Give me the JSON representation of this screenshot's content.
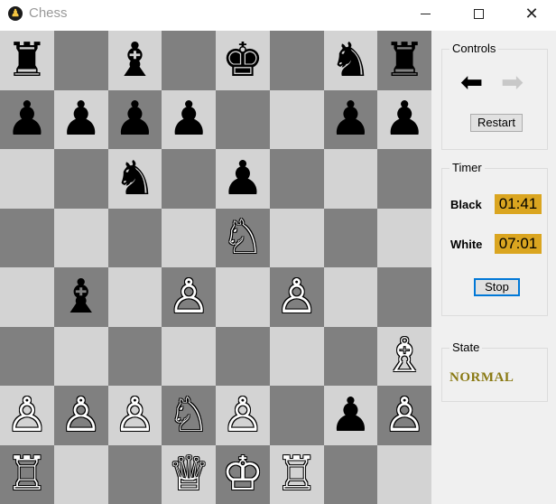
{
  "window": {
    "title": "Chess",
    "app_icon": "chess-pawn-icon",
    "minimize_icon": "minimize-icon",
    "maximize_icon": "maximize-icon",
    "close_icon": "close-icon"
  },
  "board": {
    "light_color": "#d3d3d3",
    "dark_color": "#808080",
    "rows": [
      [
        "♜",
        "",
        "♝",
        "",
        "♚",
        "",
        "♞",
        "♜"
      ],
      [
        "♟",
        "♟",
        "♟",
        "♟",
        "",
        "",
        "♟",
        "♟"
      ],
      [
        "",
        "",
        "♞",
        "",
        "♟",
        "",
        "",
        ""
      ],
      [
        "",
        "",
        "",
        "",
        "♘",
        "",
        "",
        ""
      ],
      [
        "",
        "♝",
        "",
        "♙",
        "",
        "♙",
        "",
        ""
      ],
      [
        "",
        "",
        "",
        "",
        "",
        "",
        "",
        "♗"
      ],
      [
        "♙",
        "♙",
        "♙",
        "♘",
        "♙",
        "",
        "♟",
        "♙"
      ],
      [
        "♖",
        "",
        "",
        "♕",
        "♔",
        "♖",
        "",
        ""
      ]
    ],
    "colors": [
      [
        "b",
        "",
        "b",
        "",
        "b",
        "",
        "b",
        "b"
      ],
      [
        "b",
        "b",
        "b",
        "b",
        "",
        "",
        "b",
        "b"
      ],
      [
        "",
        "",
        "b",
        "",
        "b",
        "",
        "",
        ""
      ],
      [
        "",
        "",
        "",
        "",
        "w",
        "",
        "",
        ""
      ],
      [
        "",
        "b",
        "",
        "w",
        "",
        "w",
        "",
        ""
      ],
      [
        "",
        "",
        "",
        "",
        "",
        "",
        "",
        "w"
      ],
      [
        "w",
        "w",
        "w",
        "w",
        "w",
        "",
        "b",
        "w"
      ],
      [
        "w",
        "",
        "",
        "w",
        "w",
        "w",
        "",
        ""
      ]
    ]
  },
  "controls": {
    "title": "Controls",
    "undo_icon": "undo-arrow-icon",
    "redo_icon": "redo-arrow-icon",
    "undo_glyph": "⬅",
    "redo_glyph": "➡",
    "restart_label": "Restart"
  },
  "timer": {
    "title": "Timer",
    "black_label": "Black",
    "black_value": "01:41",
    "white_label": "White",
    "white_value": "07:01",
    "stop_label": "Stop",
    "value_bg": "#daa520"
  },
  "state": {
    "title": "State",
    "value": "NORMAL"
  }
}
